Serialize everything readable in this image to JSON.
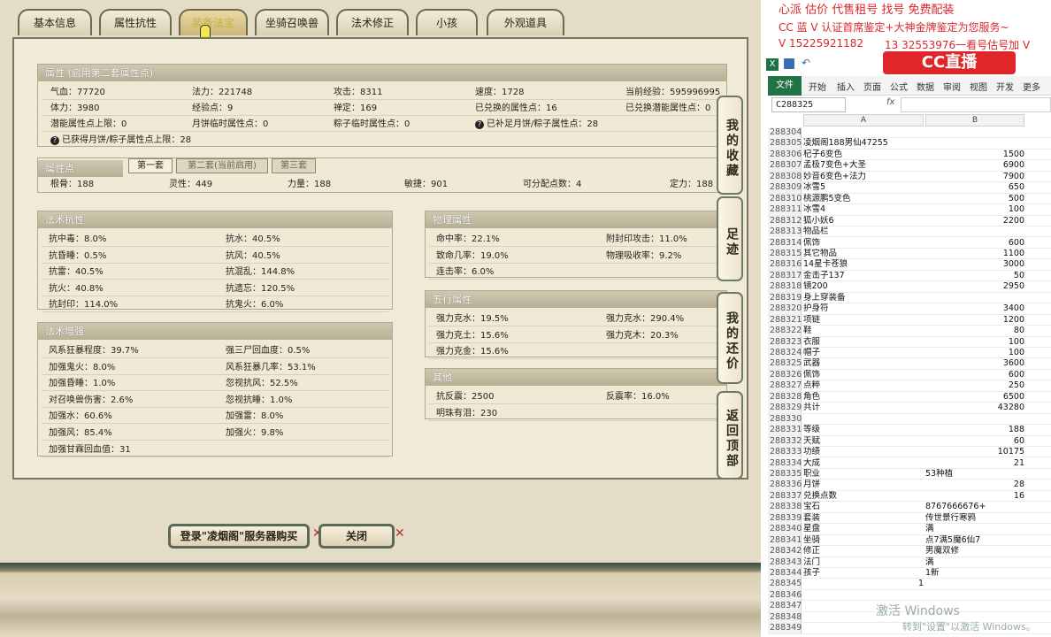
{
  "tabs": [
    "基本信息",
    "属性抗性",
    "装备法宝",
    "坐骑召唤兽",
    "法术修正",
    "小孩",
    "外观道具"
  ],
  "attr": {
    "title": "属性 (启用第二套属性点)",
    "rows": [
      [
        "气血：77720",
        "法力：221748",
        "攻击：8311",
        "速度：1728",
        "当前经验：595996995"
      ],
      [
        "体力：3980",
        "经验点：9",
        "禅定：169",
        "已兑换的属性点：16",
        "已兑换潜能属性点：0"
      ],
      [
        "潜能属性点上限：0",
        "月饼临时属性点：0",
        "粽子临时属性点：0",
        "已补足月饼/粽子属性点：28",
        ""
      ]
    ],
    "note": "已获得月饼/粽子属性点上限：28"
  },
  "points": {
    "title": "属性点",
    "subtabs": [
      "第一套",
      "第二套(当前启用)",
      "第三套"
    ],
    "values": [
      "根骨：188",
      "灵性：449",
      "力量：188",
      "敏捷：901",
      "可分配点数：4",
      "定力：188"
    ]
  },
  "resist": {
    "title": "法术抗性",
    "left": [
      "抗中毒：8.0%",
      "抗昏睡：0.5%",
      "抗雷：40.5%",
      "抗火：40.8%",
      "抗封印：114.0%"
    ],
    "right": [
      "抗水：40.5%",
      "抗风：40.5%",
      "抗混乱：144.8%",
      "抗遗忘：120.5%",
      "抗鬼火：6.0%"
    ]
  },
  "enhance": {
    "title": "法术增强",
    "left": [
      "风系狂暴程度：39.7%",
      "加强鬼火：8.0%",
      "加强昏睡：1.0%",
      "对召唤兽伤害：2.6%",
      "加强水：60.6%",
      "加强风：85.4%",
      "加强甘霖回血值：31"
    ],
    "right": [
      "强三尸回血度：0.5%",
      "风系狂暴几率：53.1%",
      "忽视抗风：52.5%",
      "忽视抗睡：1.0%",
      "加强雷：8.0%",
      "加强火：9.8%",
      ""
    ]
  },
  "phys": {
    "title": "物理属性",
    "left": [
      "命中率：22.1%",
      "致命几率：19.0%",
      "连击率：6.0%"
    ],
    "right": [
      "附封印攻击：11.0%",
      "物理吸收率：9.2%",
      ""
    ]
  },
  "wuxing": {
    "title": "五行属性",
    "left": [
      "强力克水：19.5%",
      "强力克土：15.6%",
      "强力克金：15.6%"
    ],
    "right": [
      "强力克水：290.4%",
      "强力克木：20.3%",
      ""
    ]
  },
  "other": {
    "title": "其他",
    "left": [
      "抗反震：2500",
      "明珠有泪：230"
    ],
    "right": [
      "反震率：16.0%",
      ""
    ]
  },
  "side": [
    "我的收藏",
    "足迹",
    "我的还价",
    "返回顶部"
  ],
  "buttons": {
    "login": "登录\"凌烟阁\"服务器购买",
    "close": "关闭"
  },
  "ad": {
    "line1": "心派 估价 代售租号 找号 免费配装",
    "line2": "CC 蓝 V 认证首席鉴定+大神金牌鉴定为您服务~",
    "line3a": "V 15225921182",
    "line3b": "13 32553976一看号估号加 V",
    "logo": "CC直播"
  },
  "excel": {
    "file": "文件",
    "menu": [
      "开始",
      "插入",
      "页面",
      "公式",
      "数据",
      "审阅",
      "视图",
      "开发",
      "更多"
    ],
    "namebox": "C288325",
    "fx": "fx",
    "colA": "A",
    "colB": "B",
    "rows": [
      [
        "288304",
        "",
        ""
      ],
      [
        "288305",
        "凌烟阁188男仙47255",
        ""
      ],
      [
        "288306",
        "杞子6变色",
        "1500"
      ],
      [
        "288307",
        "孟极7变色+大圣",
        "6900"
      ],
      [
        "288308",
        "妙音6变色+法力",
        "7900"
      ],
      [
        "288309",
        "冰雪5",
        "650"
      ],
      [
        "288310",
        "桃源鹏5变色",
        "500"
      ],
      [
        "288311",
        "冰雪4",
        "100"
      ],
      [
        "288312",
        "狐小妖6",
        "2200"
      ],
      [
        "288313",
        "物品栏",
        ""
      ],
      [
        "288314",
        "佩饰",
        "600"
      ],
      [
        "288315",
        "其它物品",
        "1100"
      ],
      [
        "288316",
        "14星卡苍狼",
        "3000"
      ],
      [
        "288317",
        "金击子137",
        "50"
      ],
      [
        "288318",
        "镜200",
        "2950"
      ],
      [
        "288319",
        "身上穿装备",
        ""
      ],
      [
        "288320",
        "护身符",
        "3400"
      ],
      [
        "288321",
        "项链",
        "1200"
      ],
      [
        "288322",
        "鞋",
        "80"
      ],
      [
        "288323",
        "衣服",
        "100"
      ],
      [
        "288324",
        "帽子",
        "100"
      ],
      [
        "288325",
        "武器",
        "3600"
      ],
      [
        "288326",
        "佩饰",
        "600"
      ],
      [
        "288327",
        "点粹",
        "250"
      ],
      [
        "288328",
        "角色",
        "6500"
      ],
      [
        "288329",
        "共计",
        "43280"
      ],
      [
        "288330",
        "",
        ""
      ],
      [
        "288331",
        "等级",
        "188"
      ],
      [
        "288332",
        "天赋",
        "60"
      ],
      [
        "288333",
        "功绩",
        "10175"
      ],
      [
        "288334",
        "大成",
        "21"
      ],
      [
        "288335",
        "职业",
        "53种植"
      ],
      [
        "288336",
        "月饼",
        "28"
      ],
      [
        "288337",
        "兑换点数",
        "16"
      ],
      [
        "288338",
        "宝石",
        "8767666676+"
      ],
      [
        "288339",
        "套装",
        "传世景行寒鸦"
      ],
      [
        "288340",
        "星盘",
        "满"
      ],
      [
        "288341",
        "坐骑",
        "点7满5魔6仙7"
      ],
      [
        "288342",
        "修正",
        "男魔双修"
      ],
      [
        "288343",
        "法门",
        "满"
      ],
      [
        "288344",
        "孩子",
        "1新"
      ],
      [
        "288345",
        "1",
        ""
      ],
      [
        "288346",
        "",
        ""
      ],
      [
        "288347",
        "",
        ""
      ],
      [
        "288348",
        "",
        ""
      ],
      [
        "288349",
        "",
        ""
      ]
    ],
    "wm1": "激活 Windows",
    "wm2": "转到\"设置\"以激活 Windows。"
  }
}
